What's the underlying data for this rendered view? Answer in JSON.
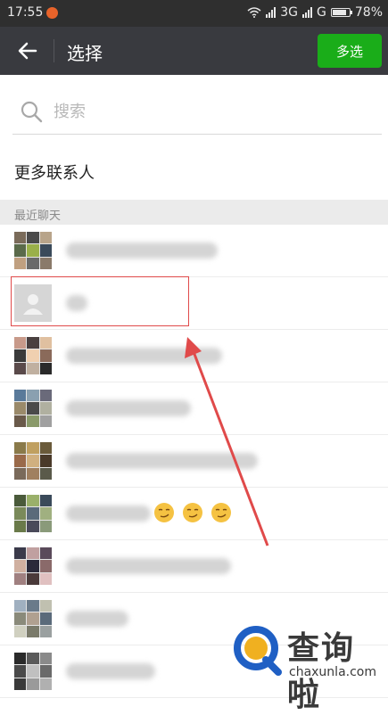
{
  "status_bar": {
    "time": "17:55",
    "network": "3G",
    "network2": "G",
    "battery": "78%"
  },
  "title_bar": {
    "title": "选择",
    "multi_select_label": "多选"
  },
  "search": {
    "placeholder": "搜索"
  },
  "more_contacts_label": "更多联系人",
  "section_header": "最近聊天",
  "recent_chats": [
    {
      "avatar": "group-avatar",
      "name": "blurred"
    },
    {
      "avatar": "default-avatar",
      "name": "blurred",
      "highlighted": true
    },
    {
      "avatar": "group-avatar",
      "name": "blurred"
    },
    {
      "avatar": "group-avatar",
      "name": "blurred"
    },
    {
      "avatar": "group-avatar",
      "name": "blurred"
    },
    {
      "avatar": "group-avatar",
      "name": "blurred",
      "emoji": [
        "smirk",
        "smirk",
        "smirk"
      ]
    },
    {
      "avatar": "group-avatar",
      "name": "blurred"
    },
    {
      "avatar": "group-avatar",
      "name": "blurred"
    },
    {
      "avatar": "group-avatar",
      "name": "blurred"
    }
  ],
  "colors": {
    "accent": "#1aad19",
    "title_bar": "#393a3f",
    "annotation": "#e04a4a"
  },
  "watermark": {
    "cn": "查询啦",
    "en": "chaxunla.com"
  }
}
